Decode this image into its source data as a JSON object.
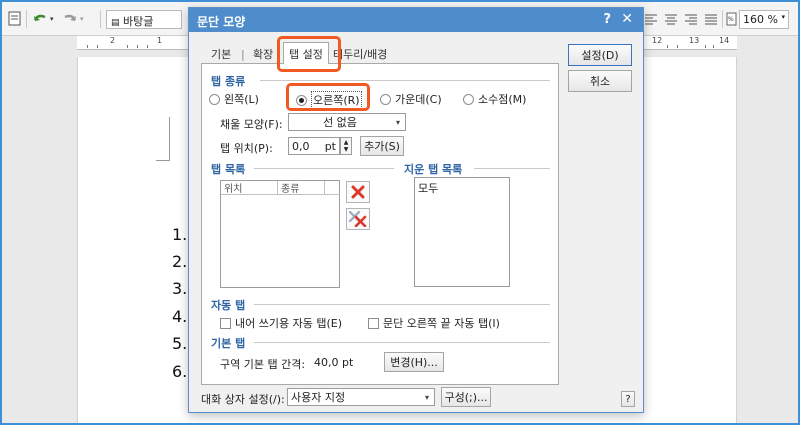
{
  "toolbar": {
    "style_value": "바탕글",
    "zoom_value": "160",
    "zoom_unit": "%"
  },
  "ruler": {
    "numbers": [
      "2",
      "1",
      "12",
      "13",
      "14"
    ]
  },
  "document": {
    "list_numbers": [
      "1.",
      "2.",
      "3.",
      "4.",
      "5.",
      "6."
    ]
  },
  "dialog": {
    "title": "문단 모양",
    "help_label": "?",
    "close_label": "✕",
    "tabs": [
      {
        "label": "기본",
        "active": false
      },
      {
        "label": "확장",
        "active": false
      },
      {
        "label": "탭 설정",
        "active": true
      },
      {
        "label": "테두리/배경",
        "active": false
      }
    ],
    "tab_separator": "|",
    "tab_type": {
      "section_label": "탭 종류",
      "options": [
        {
          "label": "왼쪽(L)",
          "selected": false
        },
        {
          "label": "오른쪽(R)",
          "selected": true
        },
        {
          "label": "가운데(C)",
          "selected": false
        },
        {
          "label": "소수점(M)",
          "selected": false
        }
      ],
      "fill_label": "채울 모양(F):",
      "fill_value": "선 없음",
      "position_label": "탭 위치(P):",
      "position_value": "0,0",
      "position_unit": "pt",
      "add_button": "추가(S)"
    },
    "tab_list": {
      "section_label": "탭 목록",
      "columns": [
        "위치",
        "종류"
      ]
    },
    "cleared_tabs": {
      "section_label": "지운 탭 목록",
      "items": [
        "모두"
      ]
    },
    "auto_tab": {
      "section_label": "자동 탭",
      "options": [
        {
          "label": "내어 쓰기용 자동 탭(E)",
          "checked": false
        },
        {
          "label": "문단 오른쪽 끝 자동 탭(I)",
          "checked": false
        }
      ]
    },
    "default_tab": {
      "section_label": "기본 탭",
      "interval_label": "구역 기본 탭 간격:",
      "interval_value": "40,0 pt",
      "change_button": "변경(H)..."
    },
    "buttons": {
      "ok": "설정(D)",
      "cancel": "취소"
    },
    "footer": {
      "setting_label": "대화 상자 설정(/):",
      "setting_value": "사용자 지정",
      "compose_button": "구성(;)...",
      "help_button": "?"
    }
  },
  "colors": {
    "accent": "#4f8ccc",
    "section_label": "#2f65a5",
    "highlight": "#f05a22",
    "delete_red": "#d9382b"
  }
}
